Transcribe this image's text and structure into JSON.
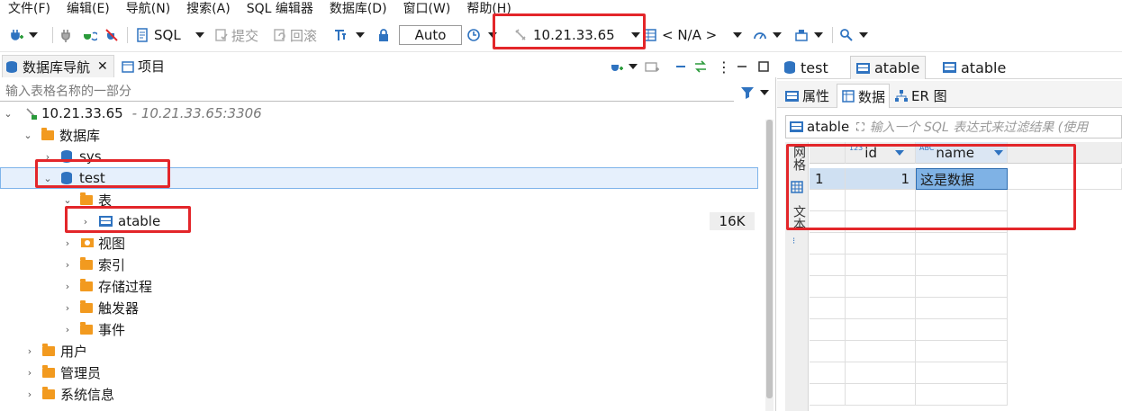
{
  "menu": [
    "文件(F)",
    "编辑(E)",
    "导航(N)",
    "搜索(A)",
    "SQL 编辑器",
    "数据库(D)",
    "窗口(W)",
    "帮助(H)"
  ],
  "toolbar": {
    "sql_label": "SQL",
    "commit_label": "提交",
    "rollback_label": "回滚",
    "auto_label": "Auto",
    "connection_label": "10.21.33.65",
    "schema_label": "< N/A >"
  },
  "left_tabs": {
    "navigator": "数据库导航",
    "projects": "项目"
  },
  "filter_placeholder": "输入表格名称的一部分",
  "tree": {
    "connection_name": "10.21.33.65",
    "connection_detail": "- 10.21.33.65:3306",
    "databases_label": "数据库",
    "sys_label": "sys",
    "test_label": "test",
    "tables_label": "表",
    "atable_label": "atable",
    "atable_size": "16K",
    "views_label": "视图",
    "indexes_label": "索引",
    "procedures_label": "存储过程",
    "triggers_label": "触发器",
    "events_label": "事件",
    "users_label": "用户",
    "admins_label": "管理员",
    "sysinfo_label": "系统信息"
  },
  "editor_tabs": [
    "test",
    "atable",
    "atable"
  ],
  "sub_tabs": {
    "properties": "属性",
    "data": "数据",
    "er": "ER 图"
  },
  "sql_filter": {
    "table": "atable",
    "placeholder": "输入一个 SQL 表达式来过滤结果 (使用"
  },
  "grid": {
    "vertical_tabs": {
      "grid": "网格",
      "text": "文本"
    },
    "type_numeric": "123",
    "type_text": "ABC",
    "columns": [
      "id",
      "name"
    ],
    "rows": [
      {
        "num": "1",
        "id": "1",
        "name": "这是数据"
      }
    ]
  },
  "colors": {
    "highlight": "#e3262a",
    "selection": "#7fb2e5",
    "accent": "#2f73c0",
    "folder": "#f29a1f"
  }
}
